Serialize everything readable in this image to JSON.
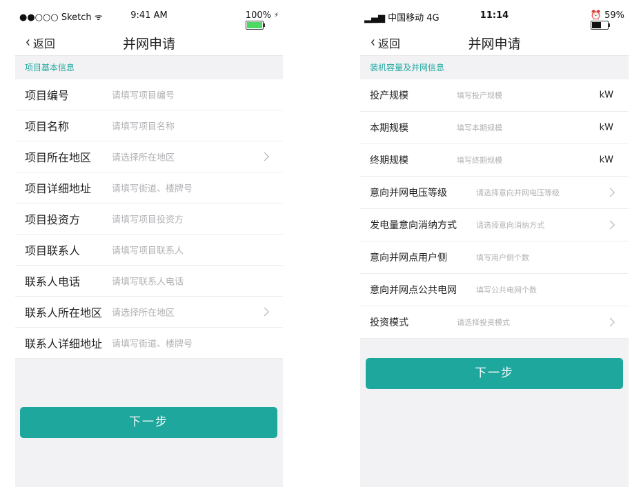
{
  "left": {
    "status": {
      "carrier": "●●○○○ Sketch ᯤ",
      "time": "9:41 AM",
      "battery": "100%",
      "battery_level": 1.0
    },
    "nav": {
      "back": "返回",
      "title": "并网申请"
    },
    "section_title": "项目基本信息",
    "rows": [
      {
        "label": "项目编号",
        "placeholder": "请填写项目编号",
        "arrow": false
      },
      {
        "label": "项目名称",
        "placeholder": "请填写项目名称",
        "arrow": false
      },
      {
        "label": "项目所在地区",
        "placeholder": "请选择所在地区",
        "arrow": true
      },
      {
        "label": "项目详细地址",
        "placeholder": "请填写街道、楼牌号",
        "arrow": false
      },
      {
        "label": "项目投资方",
        "placeholder": "请填写项目投资方",
        "arrow": false
      },
      {
        "label": "项目联系人",
        "placeholder": "请填写项目联系人",
        "arrow": false
      },
      {
        "label": "联系人电话",
        "placeholder": "请填写联系人电话",
        "arrow": false
      },
      {
        "label": "联系人所在地区",
        "placeholder": "请选择所在地区",
        "arrow": true
      },
      {
        "label": "联系人详细地址",
        "placeholder": "请填写街道、楼牌号",
        "arrow": false
      }
    ],
    "next_button": "下一步"
  },
  "right": {
    "status": {
      "carrier": "▂▄▆ 中国移动  4G",
      "time": "11:14",
      "battery": "⏰ 59%",
      "battery_level": 0.59
    },
    "nav": {
      "back": "返回",
      "title": "并网申请"
    },
    "section_title": "装机容量及并网信息",
    "rows": [
      {
        "label": "投产规模",
        "placeholder": "填写投产规模",
        "unit": "kW",
        "arrow": false
      },
      {
        "label": "本期规模",
        "placeholder": "填写本期规模",
        "unit": "kW",
        "arrow": false
      },
      {
        "label": "终期规模",
        "placeholder": "填写终期规模",
        "unit": "kW",
        "arrow": false
      },
      {
        "label": "意向并网电压等级",
        "placeholder": "请选择意向并网电压等级",
        "unit": "",
        "arrow": true
      },
      {
        "label": "发电量意向消纳方式",
        "placeholder": "请选择意向消纳方式",
        "unit": "",
        "arrow": true
      },
      {
        "label": "意向并网点用户侧",
        "placeholder": "填写用户侧个数",
        "unit": "",
        "arrow": false
      },
      {
        "label": "意向并网点公共电网",
        "placeholder": "填写公共电网个数",
        "unit": "",
        "arrow": false
      },
      {
        "label": "投资模式",
        "placeholder": "请选择投资模式",
        "unit": "",
        "arrow": true
      }
    ],
    "next_button": "下一步"
  },
  "colors": {
    "accent": "#1ea79d",
    "section_text": "#20a9a0",
    "placeholder": "#b2b2b6",
    "background": "#f2f2f4"
  }
}
